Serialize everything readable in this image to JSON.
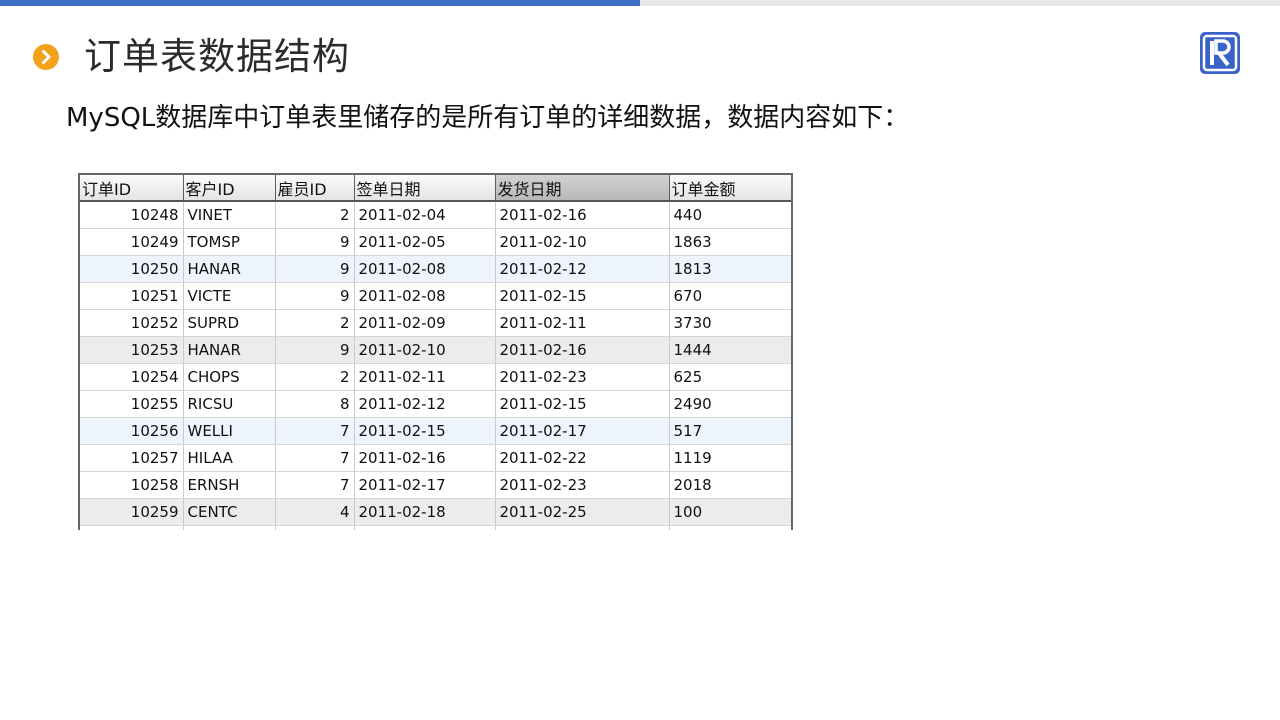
{
  "progress": {
    "fraction": 0.5,
    "color": "#3f6fc4"
  },
  "header": {
    "title": "订单表数据结构",
    "bullet_icon": "chevron-right-icon",
    "logo_icon": "r-logo-icon"
  },
  "subtitle": "MySQL数据库中订单表里储存的是所有订单的详细数据，数据内容如下：",
  "table": {
    "columns": [
      "订单ID",
      "客户ID",
      "雇员ID",
      "签单日期",
      "发货日期",
      "订单金额"
    ],
    "sorted_column": "发货日期",
    "rows": [
      [
        "10248",
        "VINET",
        "2",
        "2011-02-04",
        "2011-02-16",
        "440"
      ],
      [
        "10249",
        "TOMSP",
        "9",
        "2011-02-05",
        "2011-02-10",
        "1863"
      ],
      [
        "10250",
        "HANAR",
        "9",
        "2011-02-08",
        "2011-02-12",
        "1813"
      ],
      [
        "10251",
        "VICTE",
        "9",
        "2011-02-08",
        "2011-02-15",
        "670"
      ],
      [
        "10252",
        "SUPRD",
        "2",
        "2011-02-09",
        "2011-02-11",
        "3730"
      ],
      [
        "10253",
        "HANAR",
        "9",
        "2011-02-10",
        "2011-02-16",
        "1444"
      ],
      [
        "10254",
        "CHOPS",
        "2",
        "2011-02-11",
        "2011-02-23",
        "625"
      ],
      [
        "10255",
        "RICSU",
        "8",
        "2011-02-12",
        "2011-02-15",
        "2490"
      ],
      [
        "10256",
        "WELLI",
        "7",
        "2011-02-15",
        "2011-02-17",
        "517"
      ],
      [
        "10257",
        "HILAA",
        "7",
        "2011-02-16",
        "2011-02-22",
        "1119"
      ],
      [
        "10258",
        "ERNSH",
        "7",
        "2011-02-17",
        "2011-02-23",
        "2018"
      ],
      [
        "10259",
        "CENTC",
        "4",
        "2011-02-18",
        "2011-02-25",
        "100"
      ]
    ]
  }
}
